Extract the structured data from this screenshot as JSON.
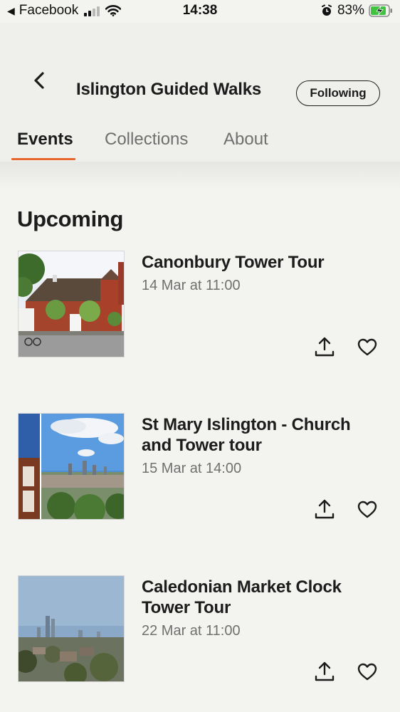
{
  "status_bar": {
    "back_app": "Facebook",
    "time": "14:38",
    "battery_percent": "83%",
    "signal_bars": 2,
    "icons": [
      "signal-icon",
      "wifi-icon",
      "alarm-icon",
      "battery-charging-icon"
    ]
  },
  "header": {
    "title": "Islington Guided Walks",
    "follow_label": "Following",
    "back_icon": "chevron-left-icon"
  },
  "tabs": [
    {
      "label": "Events",
      "active": true
    },
    {
      "label": "Collections",
      "active": false
    },
    {
      "label": "About",
      "active": false
    }
  ],
  "accent_color": "#e8662e",
  "section_title": "Upcoming",
  "events": [
    {
      "title": "Canonbury Tower Tour",
      "date": "14 Mar at 11:00",
      "actions": [
        "share-icon",
        "heart-icon"
      ]
    },
    {
      "title": "St Mary Islington - Church and Tower tour",
      "date": "15 Mar at 14:00",
      "actions": [
        "share-icon",
        "heart-icon"
      ]
    },
    {
      "title": "Caledonian Market Clock Tower Tour",
      "date": "22 Mar at 11:00",
      "actions": [
        "share-icon",
        "heart-icon"
      ]
    }
  ]
}
